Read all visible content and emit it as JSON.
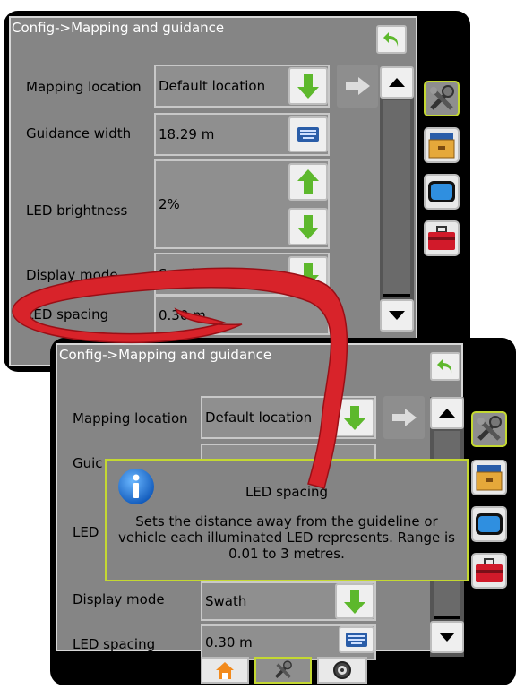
{
  "screen1": {
    "title": "Config->Mapping and guidance",
    "rows": {
      "mapping_location": {
        "label": "Mapping location",
        "value": "Default location"
      },
      "guidance_width": {
        "label": "Guidance width",
        "value": "18.29 m"
      },
      "led_brightness": {
        "label": "LED brightness",
        "value": "2%"
      },
      "display_mode": {
        "label": "Display mode",
        "value": "Swath"
      },
      "led_spacing": {
        "label": "LED spacing",
        "value": "0.30 m"
      }
    }
  },
  "screen2": {
    "title": "Config->Mapping and guidance",
    "rows": {
      "mapping_location": {
        "label": "Mapping location",
        "value": "Default location"
      },
      "guidance_width": {
        "label": "Guic"
      },
      "led_brightness": {
        "label": "LED"
      },
      "display_mode": {
        "label": "Display mode",
        "value": "Swath"
      },
      "led_spacing": {
        "label": "LED spacing",
        "value": "0.30 m"
      }
    },
    "popup": {
      "title": "LED spacing",
      "body": "Sets the distance away from the guideline or vehicle each illuminated LED represents. Range is 0.01 to 3 metres."
    }
  },
  "icons": {
    "back": "back-arrow-icon",
    "down": "green-down-arrow-icon",
    "up": "green-up-arrow-icon",
    "next": "right-arrow-icon",
    "keyboard": "keyboard-icon",
    "tools": "tools-icon",
    "data": "data-files-icon",
    "display": "display-screen-icon",
    "toolbox": "toolbox-icon",
    "home": "home-icon",
    "gauge": "gauge-icon",
    "info": "info-icon"
  },
  "colors": {
    "panel": "#858585",
    "accent": "#c4d832",
    "green": "#5db82c",
    "callout_red": "#d8232a"
  }
}
